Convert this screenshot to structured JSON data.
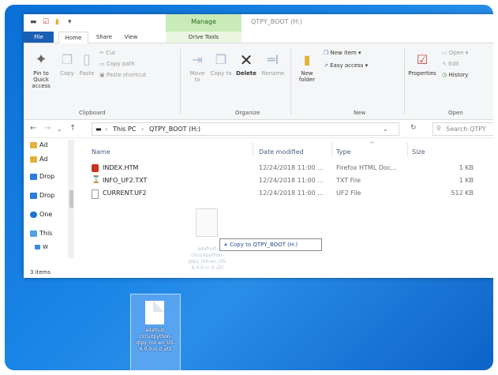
{
  "window": {
    "title": "QTPY_BOOT (H:)",
    "manage_label": "Manage"
  },
  "tabs": {
    "file": "File",
    "home": "Home",
    "share": "Share",
    "view": "View",
    "drive_tools": "Drive Tools"
  },
  "ribbon": {
    "pin": "Pin to Quick access",
    "copy": "Copy",
    "paste": "Paste",
    "cut": "Cut",
    "copy_path": "Copy path",
    "paste_shortcut": "Paste shortcut",
    "clipboard_group": "Clipboard",
    "move_to": "Move to",
    "copy_to": "Copy to",
    "delete": "Delete",
    "rename": "Rename",
    "organize_group": "Organize",
    "new_folder": "New folder",
    "new_item": "New item",
    "easy_access": "Easy access",
    "new_group": "New",
    "properties": "Properties",
    "open": "Open",
    "edit": "Edit",
    "history": "History",
    "open_group": "Open"
  },
  "address": {
    "crumbs": [
      "This PC",
      "QTPY_BOOT (H:)"
    ],
    "search_placeholder": "Search QTPY"
  },
  "nav_pane": {
    "items": [
      {
        "label": "Ad",
        "icon": "folder-icon"
      },
      {
        "label": "Ad",
        "icon": "folder-icon"
      },
      {
        "label": "Drop",
        "icon": "dropbox-icon"
      },
      {
        "label": "Drop",
        "icon": "dropbox-icon"
      },
      {
        "label": "One",
        "icon": "onedrive-icon"
      },
      {
        "label": "This",
        "icon": "pc-icon"
      },
      {
        "label": "W",
        "icon": "drive-icon"
      }
    ]
  },
  "columns": {
    "name": "Name",
    "date": "Date modified",
    "type": "Type",
    "size": "Size"
  },
  "files": [
    {
      "name": "INDEX.HTM",
      "date": "12/24/2018 11:00 ...",
      "type": "Firefox HTML Doc...",
      "size": "1 KB",
      "icon": "firefox-icon"
    },
    {
      "name": "INFO_UF2.TXT",
      "date": "12/24/2018 11:00 ...",
      "type": "TXT File",
      "size": "1 KB",
      "icon": "text-file-icon"
    },
    {
      "name": "CURRENT.UF2",
      "date": "12/24/2018 11:00 ...",
      "type": "UF2 File",
      "size": "512 KB",
      "icon": "blank-file-icon"
    }
  ],
  "status": {
    "items": "3 items"
  },
  "drag": {
    "tooltip_prefix": "+",
    "tooltip": "Copy to QTPY_BOOT (H:)",
    "ghost_label": "adafruit-circuitpython-qtpy_m0-en_US-6.0.0-rc.0.uf2"
  },
  "desktop": {
    "file_label": "adafruit-circuitpython-qtpy_m0-en_US-6.0.0-rc.0.uf2"
  },
  "colors": {
    "file_tab": "#1a5fb4",
    "manage": "#c9ebb7",
    "desktop": "#1b86e6"
  }
}
